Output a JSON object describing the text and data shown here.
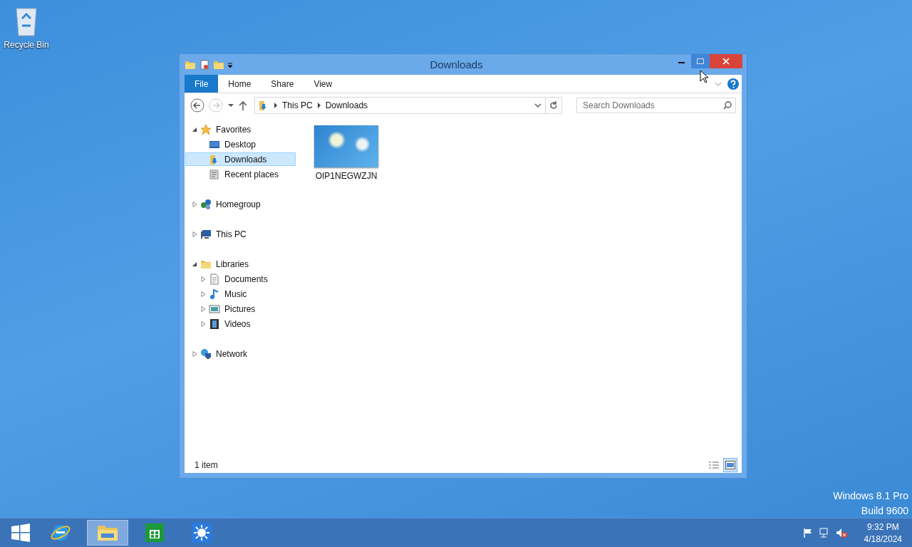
{
  "desktop": {
    "icons": [
      {
        "label": "Recycle Bin"
      }
    ],
    "watermark": [
      "Windows 8.1 Pro",
      "Build 9600"
    ]
  },
  "window": {
    "title": "Downloads",
    "controls": [
      {
        "kind": "minimize",
        "hovered": false
      },
      {
        "kind": "maximize",
        "hovered": true
      },
      {
        "kind": "close",
        "hovered": false
      }
    ],
    "ribbon_tabs": [
      {
        "label": "File",
        "kind": "file"
      },
      {
        "label": "Home",
        "kind": "tab"
      },
      {
        "label": "Share",
        "kind": "tab"
      },
      {
        "label": "View",
        "kind": "tab"
      }
    ],
    "address": {
      "breadcrumbs": [
        "This PC",
        "Downloads"
      ]
    },
    "search": {
      "placeholder": "Search Downloads"
    },
    "nav_tree": [
      {
        "label": "Favorites",
        "kind": "star",
        "expanded": true,
        "selected": false,
        "children": [
          {
            "label": "Desktop",
            "kind": "desktop",
            "selected": false
          },
          {
            "label": "Downloads",
            "kind": "downloads",
            "selected": true
          },
          {
            "label": "Recent places",
            "kind": "recent",
            "selected": false
          }
        ]
      },
      {
        "label": "Homegroup",
        "kind": "homegroup",
        "expanded": false,
        "selected": false
      },
      {
        "label": "This PC",
        "kind": "pc",
        "expanded": false,
        "selected": false
      },
      {
        "label": "Libraries",
        "kind": "libraries",
        "expanded": true,
        "selected": false,
        "children": [
          {
            "label": "Documents",
            "kind": "documents",
            "expanded": false,
            "selected": false
          },
          {
            "label": "Music",
            "kind": "music",
            "expanded": false,
            "selected": false
          },
          {
            "label": "Pictures",
            "kind": "pictures",
            "expanded": false,
            "selected": false
          },
          {
            "label": "Videos",
            "kind": "videos",
            "expanded": false,
            "selected": false
          }
        ]
      },
      {
        "label": "Network",
        "kind": "network",
        "expanded": false,
        "selected": false
      }
    ],
    "files": [
      {
        "name": "OIP1NEGWZJN"
      }
    ],
    "status": "1 item",
    "views": [
      {
        "kind": "details",
        "selected": false
      },
      {
        "kind": "large_icons",
        "selected": true
      }
    ]
  },
  "taskbar": {
    "apps": [
      {
        "kind": "ie",
        "active": false
      },
      {
        "kind": "explorer",
        "active": true
      },
      {
        "kind": "store",
        "active": false
      },
      {
        "kind": "weather",
        "active": false
      }
    ],
    "clock": {
      "time": "9:32 PM",
      "date": "4/18/2024"
    }
  }
}
